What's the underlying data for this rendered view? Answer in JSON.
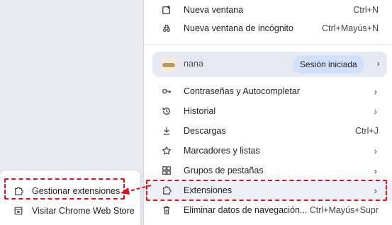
{
  "menu": {
    "items_top": [
      {
        "label": "Nueva ventana",
        "shortcut": "Ctrl+N",
        "icon": "new-window-icon"
      },
      {
        "label": "Nueva ventana de incógnito",
        "shortcut": "Ctrl+Mayús+N",
        "icon": "incognito-icon"
      }
    ],
    "profile": {
      "name": "nana",
      "status": "Sesión iniciada",
      "icon": "avatar"
    },
    "items_main": [
      {
        "label": "Contraseñas y Autocompletar",
        "icon": "key-icon",
        "chevron": true
      },
      {
        "label": "Historial",
        "icon": "history-icon",
        "chevron": true
      },
      {
        "label": "Descargas",
        "shortcut": "Ctrl+J",
        "icon": "download-icon"
      },
      {
        "label": "Marcadores y listas",
        "icon": "star-icon",
        "chevron": true
      },
      {
        "label": "Grupos de pestañas",
        "icon": "tab-groups-icon",
        "chevron": true
      },
      {
        "label": "Extensiones",
        "icon": "puzzle-icon",
        "chevron": true
      },
      {
        "label": "Eliminar datos de navegación...",
        "shortcut": "Ctrl+Mayús+Supr",
        "icon": "trash-icon"
      }
    ]
  },
  "submenu": {
    "items": [
      {
        "label": "Gestionar extensiones",
        "icon": "puzzle-icon"
      },
      {
        "label": "Visitar Chrome Web Store",
        "icon": "web-store-icon"
      }
    ]
  },
  "annotation": {
    "color": "#e0101e"
  },
  "chevron": "›"
}
